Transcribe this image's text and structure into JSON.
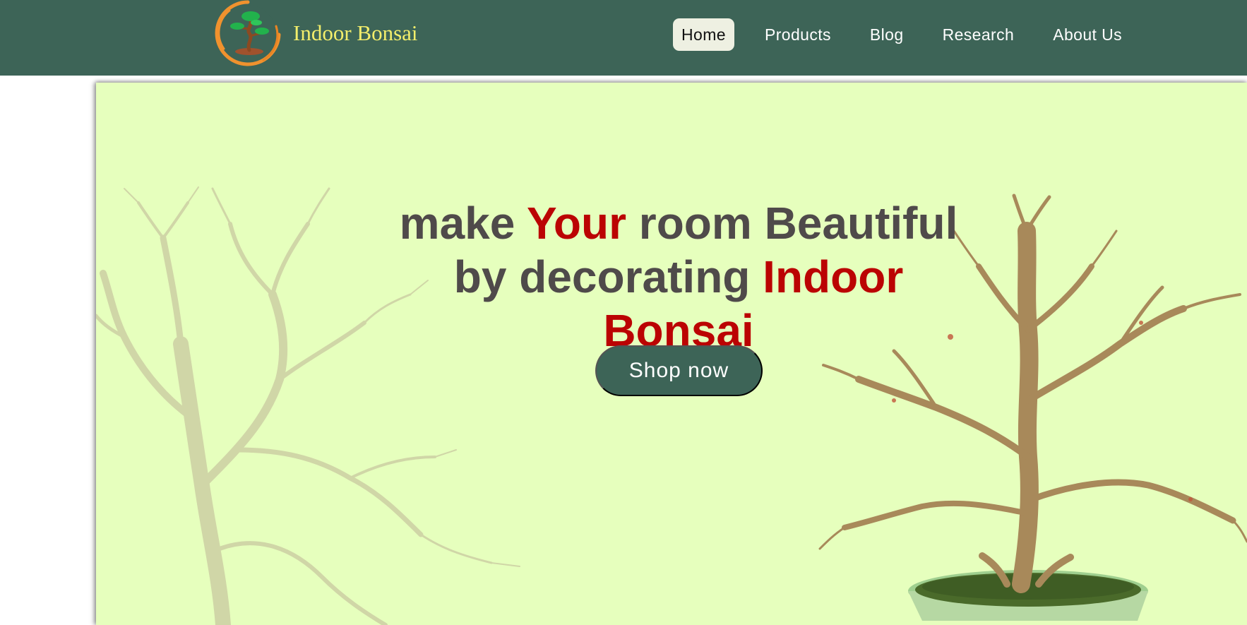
{
  "brand": {
    "name": "Indoor Bonsai",
    "logo_icon": "bonsai-logo-icon"
  },
  "nav": {
    "items": [
      {
        "label": "Home",
        "active": true
      },
      {
        "label": "Products",
        "active": false
      },
      {
        "label": "Blog",
        "active": false
      },
      {
        "label": "Research",
        "active": false
      },
      {
        "label": "About Us",
        "active": false
      }
    ]
  },
  "hero": {
    "headline": {
      "line1_a": "make ",
      "line1_b": "Your",
      "line1_c": " room Beautiful",
      "line2_a": "by decorating ",
      "line2_b": "Indoor",
      "line3": "Bonsai"
    },
    "cta_label": "Shop now",
    "decor_icons": [
      "bare-tree-left-icon",
      "bonsai-tree-pot-icon"
    ]
  },
  "colors": {
    "nav_bg": "#3d6457",
    "brand_text": "#f3ee6b",
    "hero_bg": "#e6ffbd",
    "headline_gray": "#4f4a4a",
    "accent_red": "#bb0303",
    "active_tab_bg": "#eef0e2"
  }
}
